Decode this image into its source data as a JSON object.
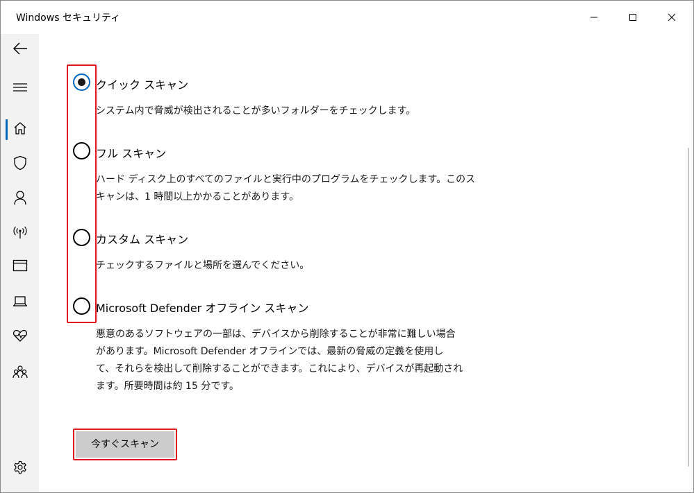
{
  "window": {
    "title": "Windows セキュリティ",
    "controls": [
      "minimize",
      "maximize",
      "close"
    ]
  },
  "sidebar": {
    "items": [
      {
        "icon": "back-arrow-icon"
      },
      {
        "icon": "hamburger-menu-icon"
      },
      {
        "icon": "home-icon"
      },
      {
        "icon": "shield-icon",
        "active": true
      },
      {
        "icon": "person-icon"
      },
      {
        "icon": "wireless-antenna-icon"
      },
      {
        "icon": "app-browser-icon"
      },
      {
        "icon": "laptop-icon"
      },
      {
        "icon": "heart-pulse-icon"
      },
      {
        "icon": "family-icon"
      },
      {
        "icon": "gear-icon"
      }
    ],
    "accent": "#0067c0"
  },
  "scan_options": [
    {
      "label": "クイック スキャン",
      "description": "システム内で脅威が検出されることが多いフォルダーをチェックします。",
      "selected": true
    },
    {
      "label": "フル スキャン",
      "description": "ハード ディスク上のすべてのファイルと実行中のプログラムをチェックします。このス\nキャンは、1 時間以上かかることがあります。",
      "selected": false
    },
    {
      "label": "カスタム スキャン",
      "description": "チェックするファイルと場所を選んでください。",
      "selected": false
    },
    {
      "label": "Microsoft Defender オフライン スキャン",
      "description": "悪意のあるソフトウェアの一部は、デバイスから削除することが非常に難しい場合\nがあります。Microsoft Defender オフラインでは、最新の脅威の定義を使用し\nて、それらを検出して削除することができます。これにより、デバイスが再起動され\nます。所要時間は約 15 分です。",
      "selected": false
    }
  ],
  "scan_button": {
    "label": "今すぐスキャン"
  },
  "colors": {
    "highlight": "#e0161d",
    "button_bg": "#cccccc",
    "sidebar_bg": "#f2f2f2"
  }
}
